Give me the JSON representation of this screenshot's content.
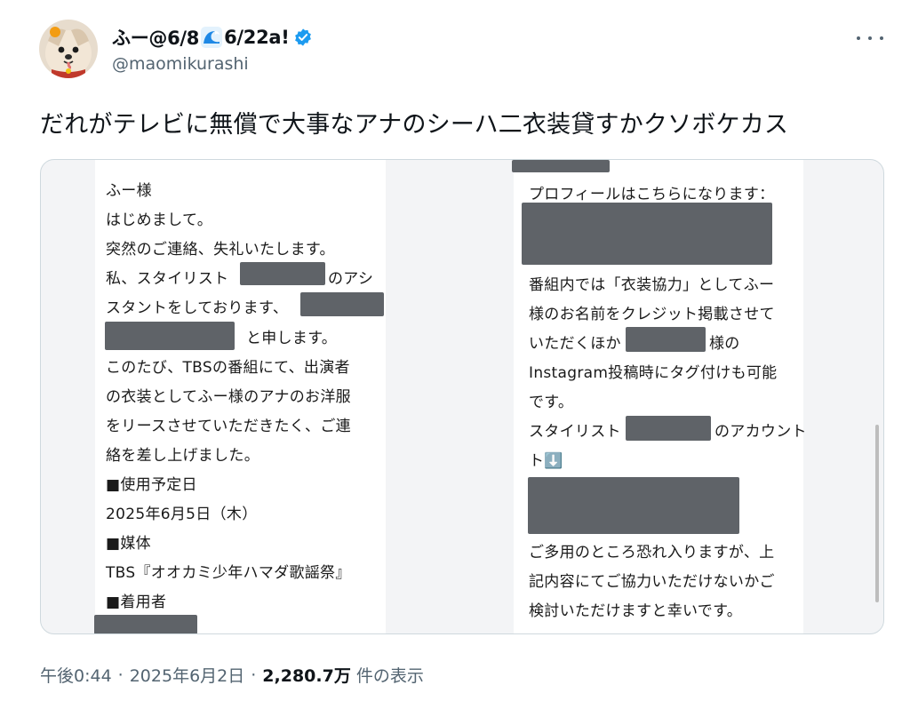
{
  "author": {
    "display_name_part1": "ふー@6/8",
    "display_name_part2": "6/22a!",
    "handle": "@maomikurashi"
  },
  "tweet": {
    "text": "だれがテレビに無償で大事なアナのシーハ二衣装貸すかクソボケカス"
  },
  "left_message": [
    "ふー様",
    "はじめまして。",
    "突然のご連絡、失礼いたします。",
    "私、スタイリスト",
    "のアシ",
    "スタントをしております、",
    "と申します。",
    "このたび、TBSの番組にて、出演者",
    "の衣装としてふー様のアナのお洋服",
    "をリースさせていただきたく、ご連",
    "絡を差し上げました。",
    "■使用予定日",
    "2025年6月5日（木）",
    "■媒体",
    "TBS『オオカミ少年ハマダ歌謡祭』",
    "■着用者"
  ],
  "right_message": [
    "プロフィールはこちらになります：",
    "番組内では「衣装協力」としてふー",
    "様のお名前をクレジット掲載させて",
    "いただくほか",
    "様の",
    "Instagram投稿時にタグ付けも可能",
    "です。",
    "スタイリスト",
    "のアカウント",
    "ト⬇️",
    "ご多用のところ恐れ入りますが、上",
    "記内容にてご協力いただけないかご",
    "検討いただけますと幸いです。"
  ],
  "meta": {
    "time": "午後0:44",
    "separator": "·",
    "date": "2025年6月2日",
    "views_count": "2,280.7万",
    "views_label": "件の表示"
  },
  "colors": {
    "verified": "#1d9bf0",
    "redaction": "#5f6368",
    "muted_text": "#536471"
  },
  "icons": {
    "avatar": "pomeranian-dog-avatar",
    "wave": "wave-emoji",
    "verified": "verified-badge-icon",
    "more": "more-options-icon",
    "down_arrow": "down-arrow-emoji"
  }
}
